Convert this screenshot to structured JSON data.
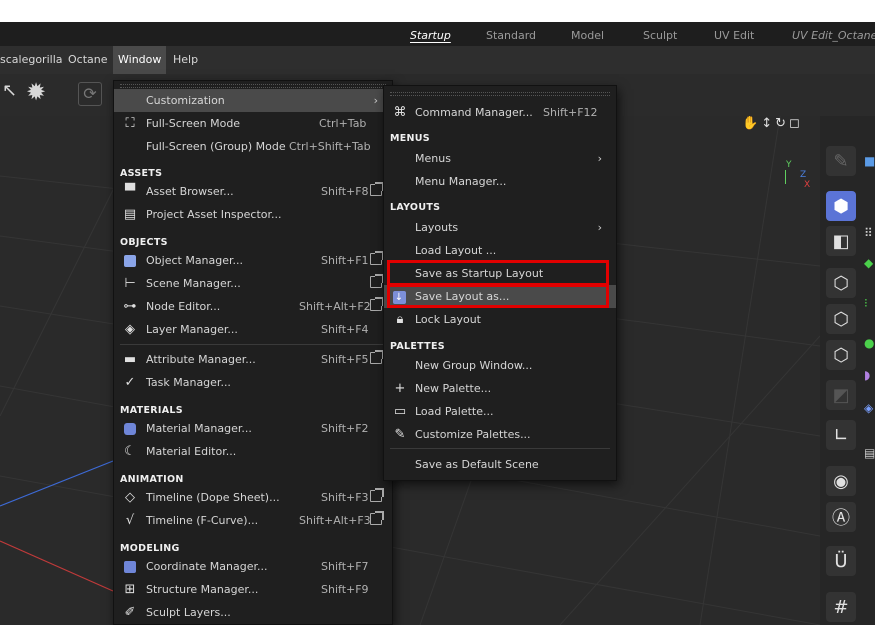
{
  "layout_tabs": [
    {
      "label": "Startup",
      "active": true
    },
    {
      "label": "Standard"
    },
    {
      "label": "Model"
    },
    {
      "label": "Sculpt"
    },
    {
      "label": "UV Edit"
    },
    {
      "label": "UV Edit_Octane"
    }
  ],
  "menubar": [
    "scalegorilla",
    "Octane",
    "Window",
    "Help"
  ],
  "active_menu": "Window",
  "window_menu": {
    "customization": "Customization",
    "fullscreen": {
      "label": "Full-Screen Mode",
      "shortcut": "Ctrl+Tab"
    },
    "fullscreen_group": {
      "label": "Full-Screen (Group) Mode",
      "shortcut": "Ctrl+Shift+Tab"
    },
    "sections": {
      "assets": "ASSETS",
      "objects": "OBJECTS",
      "materials": "MATERIALS",
      "animation": "ANIMATION",
      "modeling": "MODELING"
    },
    "asset_browser": {
      "label": "Asset Browser...",
      "shortcut": "Shift+F8"
    },
    "project_asset_inspector": {
      "label": "Project Asset Inspector..."
    },
    "object_manager": {
      "label": "Object Manager...",
      "shortcut": "Shift+F1"
    },
    "scene_manager": {
      "label": "Scene Manager..."
    },
    "node_editor": {
      "label": "Node Editor...",
      "shortcut": "Shift+Alt+F2"
    },
    "layer_manager": {
      "label": "Layer Manager...",
      "shortcut": "Shift+F4"
    },
    "attribute_manager": {
      "label": "Attribute Manager...",
      "shortcut": "Shift+F5"
    },
    "task_manager": {
      "label": "Task Manager..."
    },
    "material_manager": {
      "label": "Material Manager...",
      "shortcut": "Shift+F2"
    },
    "material_editor": {
      "label": "Material Editor..."
    },
    "timeline_dope": {
      "label": "Timeline (Dope Sheet)...",
      "shortcut": "Shift+F3"
    },
    "timeline_fcurve": {
      "label": "Timeline (F-Curve)...",
      "shortcut": "Shift+Alt+F3"
    },
    "coordinate_manager": {
      "label": "Coordinate Manager...",
      "shortcut": "Shift+F7"
    },
    "structure_manager": {
      "label": "Structure Manager...",
      "shortcut": "Shift+F9"
    },
    "sculpt_layers": {
      "label": "Sculpt Layers..."
    }
  },
  "customization_menu": {
    "command_manager": {
      "label": "Command Manager...",
      "shortcut": "Shift+F12"
    },
    "sections": {
      "menus": "MENUS",
      "layouts": "LAYOUTS",
      "palettes": "PALETTES"
    },
    "menus": "Menus",
    "menu_manager": "Menu Manager...",
    "layouts": "Layouts",
    "load_layout": "Load Layout ...",
    "save_startup_layout": "Save as Startup Layout",
    "save_layout_as": "Save Layout as...",
    "lock_layout": "Lock Layout",
    "new_group_window": "New Group Window...",
    "new_palette": "New Palette...",
    "load_palette": "Load Palette...",
    "customize_palettes": "Customize Palettes...",
    "save_default_scene": "Save as Default Scene"
  },
  "axis": {
    "y": "Y",
    "z": "Z",
    "x": "X"
  },
  "colors": {
    "highlight_box": "#e10000",
    "selected_tool": "#5b74d6",
    "axis_x": "#e04040",
    "axis_y": "#60d060",
    "axis_z": "#4a80e0"
  }
}
